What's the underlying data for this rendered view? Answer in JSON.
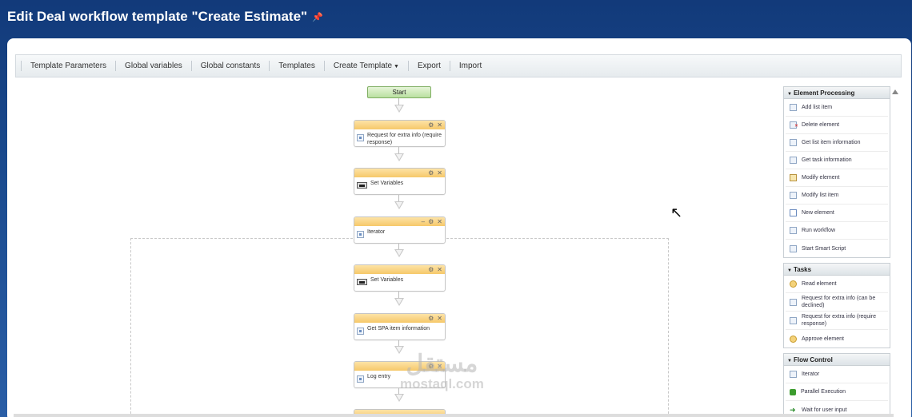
{
  "page": {
    "title": "Edit Deal workflow template \"Create Estimate\""
  },
  "toolbar": {
    "items": [
      "Template Parameters",
      "Global variables",
      "Global constants",
      "Templates",
      "Create Template",
      "Export",
      "Import"
    ]
  },
  "workflow": {
    "start_label": "Start",
    "blocks": [
      {
        "label": "Request for extra info (require response)"
      },
      {
        "label": "Set Variables"
      },
      {
        "label": "Iterator"
      },
      {
        "label": "Set Variables"
      },
      {
        "label": "Get SPA item information"
      },
      {
        "label": "Log entry"
      }
    ],
    "block_controls": {
      "minimize": "–",
      "settings": "⚙",
      "close": "✕"
    }
  },
  "sidebar": {
    "element_processing": {
      "title": "Element Processing",
      "items": [
        "Add list item",
        "Delete element",
        "Get list item information",
        "Get task information",
        "Modify element",
        "Modify list item",
        "New element",
        "Run workflow",
        "Start Smart Script"
      ]
    },
    "tasks": {
      "title": "Tasks",
      "items": [
        "Read element",
        "Request for extra info (can be declined)",
        "Request for extra info (require response)",
        "Approve element"
      ]
    },
    "flow_control": {
      "title": "Flow Control",
      "items": [
        "Iterator",
        "Parallel Execution",
        "Wait for user input"
      ]
    }
  },
  "watermark": {
    "arabic": "مستقل",
    "latin": "mostaql.com"
  }
}
